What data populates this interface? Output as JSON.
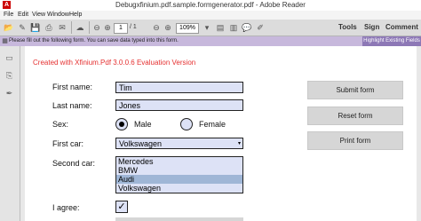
{
  "window": {
    "title": "Debugxfinium.pdf.sample.formgenerator.pdf - Adobe Reader"
  },
  "menu": [
    "File",
    "Edit",
    "View",
    "Window",
    "Help"
  ],
  "toolbar": {
    "page_current": "1",
    "page_total": "/ 1",
    "zoom": "109%",
    "tools": "Tools",
    "sign": "Sign",
    "comment": "Comment"
  },
  "message": {
    "text": "Please fill out the following form. You can save data typed into this form.",
    "highlight_button": "Highlight Existing Fields"
  },
  "form": {
    "watermark": "Created with Xfinium.Pdf 3.0.0.6 Evaluation Version",
    "first_name_label": "First name:",
    "first_name": "Tim",
    "last_name_label": "Last name:",
    "last_name": "Jones",
    "sex_label": "Sex:",
    "sex_options": [
      "Male",
      "Female"
    ],
    "sex_selected": "Male",
    "first_car_label": "First car:",
    "first_car": "Volkswagen",
    "second_car_label": "Second car:",
    "second_car_options": [
      "Mercedes",
      "BMW",
      "Audi",
      "Volkswagen"
    ],
    "second_car_selected": "Audi",
    "agree_label": "I agree:",
    "agree_checked": true,
    "agree_mark": "✓"
  },
  "buttons": {
    "submit": "Submit form",
    "reset": "Reset form",
    "print": "Print form"
  }
}
